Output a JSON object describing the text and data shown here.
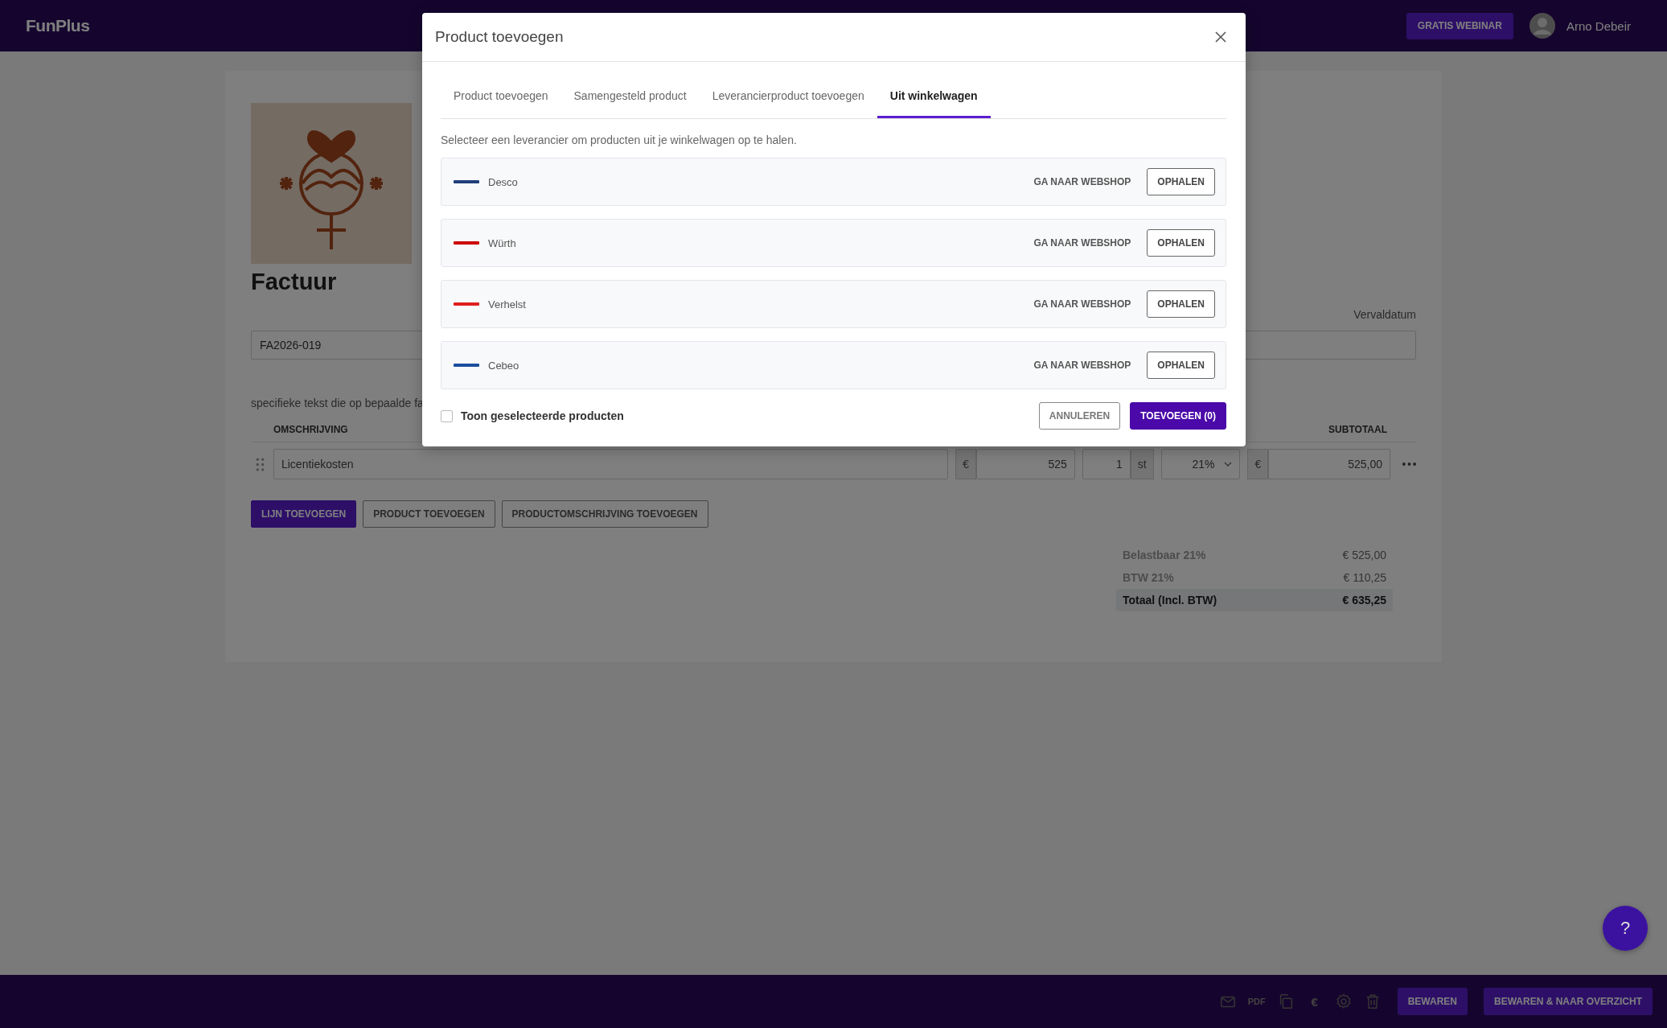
{
  "topbar": {
    "logo": "FunPlus",
    "webinar_button": "GRATIS WEBINAR",
    "user_name": "Arno Debeir"
  },
  "invoice": {
    "title": "Factuur",
    "number": "FA2026-019",
    "due_date_label": "Vervaldatum",
    "intro_text": "specifieke tekst die op bepaalde fa",
    "columns": [
      "OMSCHRIJVING",
      "SUBTOTAAL"
    ],
    "lines": [
      {
        "description": "Licentiekosten",
        "price_currency": "€",
        "price": "525",
        "quantity": "1",
        "unit": "st",
        "vat": "21%",
        "subtotal_currency": "€",
        "subtotal": "525,00"
      }
    ],
    "buttons": [
      {
        "label": "LIJN TOEVOEGEN",
        "kind": "primary"
      },
      {
        "label": "PRODUCT TOEVOEGEN",
        "kind": "outline"
      },
      {
        "label": "PRODUCTOMSCHRIJVING TOEVOEGEN",
        "kind": "outline"
      }
    ],
    "totals": [
      {
        "label": "Belastbaar 21%",
        "value": "€ 525,00",
        "kind": "line"
      },
      {
        "label": "BTW 21%",
        "value": "€ 110,25",
        "kind": "line"
      },
      {
        "label": "Totaal (Incl. BTW)",
        "value": "€ 635,25",
        "kind": "total"
      }
    ]
  },
  "modal": {
    "title": "Product toevoegen",
    "tabs": [
      {
        "label": "Product toevoegen",
        "selected": false
      },
      {
        "label": "Samengesteld product",
        "selected": false
      },
      {
        "label": "Leverancierproduct toevoegen",
        "selected": false
      },
      {
        "label": "Uit winkelwagen",
        "selected": true
      }
    ],
    "instruction": "Selecteer een leverancier om producten uit je winkelwagen op te halen.",
    "suppliers": [
      {
        "name": "Desco",
        "color": "#1f3f7a",
        "link": "GA NAAR WEBSHOP",
        "action": "OPHALEN"
      },
      {
        "name": "Würth",
        "color": "#cc0000",
        "link": "GA NAAR WEBSHOP",
        "action": "OPHALEN"
      },
      {
        "name": "Verhelst",
        "color": "#e01e1e",
        "link": "GA NAAR WEBSHOP",
        "action": "OPHALEN"
      },
      {
        "name": "Cebeo",
        "color": "#1b4f9c",
        "link": "GA NAAR WEBSHOP",
        "action": "OPHALEN"
      }
    ],
    "show_selected": {
      "label": "Toon geselecteerde producten",
      "checked": false
    },
    "buttons": [
      {
        "label": "ANNULEREN",
        "kind": "secondary"
      },
      {
        "label": "TOEVOEGEN (0)",
        "kind": "primary"
      }
    ]
  },
  "bottom_bar": {
    "tools": [
      {
        "kind": "mail"
      },
      {
        "kind": "text",
        "text": "PDF"
      },
      {
        "kind": "copy"
      },
      {
        "kind": "text",
        "text": "€"
      },
      {
        "kind": "settings"
      },
      {
        "kind": "delete"
      }
    ],
    "buttons": [
      "BEWAREN",
      "BEWAREN & NAAR OVERZICHT"
    ]
  },
  "help_button": "?"
}
